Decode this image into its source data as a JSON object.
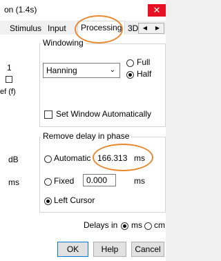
{
  "window": {
    "title": "on (1.4s)",
    "close_glyph": "✕"
  },
  "tabs": [
    {
      "label": "Stimulus"
    },
    {
      "label": "Input"
    },
    {
      "label": "Processing"
    },
    {
      "label": "3D"
    }
  ],
  "tab_scroll": {
    "left_glyph": "◀",
    "right_glyph": "▶"
  },
  "left_column": {
    "one": "1",
    "ef_label": "ef (f)",
    "db_unit": "dB",
    "ms_unit": "ms"
  },
  "windowing": {
    "group_label": "Windowing",
    "window_select": {
      "value": "Hanning"
    },
    "full_label": "Full",
    "half_label": "Half",
    "set_auto_label": "Set Window Automatically"
  },
  "remove_delay": {
    "group_label": "Remove delay in phase",
    "automatic_label": "Automatic",
    "automatic_value": "166.313",
    "automatic_unit": "ms",
    "fixed_label": "Fixed",
    "fixed_value": "0.000",
    "fixed_unit": "ms",
    "left_cursor_label": "Left Cursor"
  },
  "delays": {
    "label": "Delays in",
    "ms_label": "ms",
    "cm_label": "cm"
  },
  "buttons": {
    "ok": "OK",
    "help": "Help",
    "cancel": "Cancel"
  },
  "colors": {
    "highlight_oval": "#e8892f",
    "close_button": "#e81123"
  }
}
